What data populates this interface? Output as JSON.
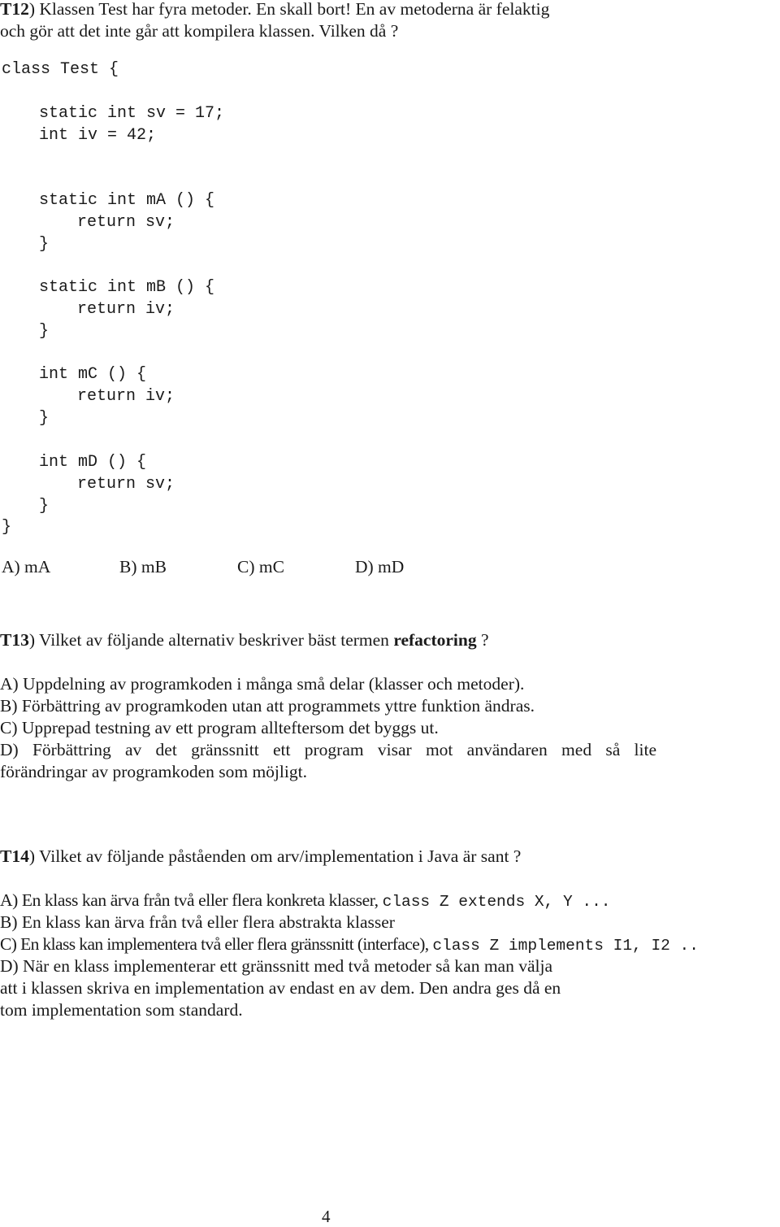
{
  "t12": {
    "label": "T12",
    "question_line1": ") Klassen Test har fyra metoder. En skall bort! En av metoderna är felaktig",
    "question_line2": "och gör att det inte går att kompilera klassen. Vilken då ?",
    "code": [
      "class Test {",
      "static int sv = 17;",
      "int iv = 42;",
      "static int mA () {",
      "return sv;",
      "}",
      "static int mB () {",
      "return iv;",
      "}",
      "int mC () {",
      "return iv;",
      "}",
      "int mD () {",
      "return sv;",
      "}",
      "}"
    ],
    "options": [
      "A) mA",
      "B) mB",
      "C) mC",
      "D) mD"
    ]
  },
  "t13": {
    "label": "T13",
    "question_pre": ") Vilket av följande alternativ beskriver bäst termen ",
    "question_bold": "refactoring",
    "question_post": " ?",
    "options": [
      "A) Uppdelning av programkoden i många små delar (klasser och metoder).",
      "B) Förbättring av programkoden utan att programmets yttre funktion ändras.",
      "C) Upprepad testning av ett program allteftersom det byggs ut.",
      "D) Förbättring av det gränssnitt ett program visar mot användaren med så lite",
      "förändringar av programkoden som möjligt."
    ]
  },
  "t14": {
    "label": "T14",
    "question": ") Vilket av följande påståenden om arv/implementation i Java är sant ?",
    "option_a_text": "A) En klass kan ärva från två eller flera konkreta klasser, ",
    "option_a_code": "class Z extends X, Y ...",
    "option_b_text": "B) En klass kan ärva från två eller flera abstrakta klasser",
    "option_c_text": "C) En klass kan implementera två eller flera gränssnitt (interface), ",
    "option_c_code": "class Z implements I1, I2 ..",
    "option_d_lines": [
      "D) När en klass implementerar ett gränssnitt med två metoder så kan man välja",
      "att i klassen skriva en implementation av endast en av dem. Den andra ges då en",
      "tom implementation som standard."
    ]
  },
  "page_number": "4"
}
